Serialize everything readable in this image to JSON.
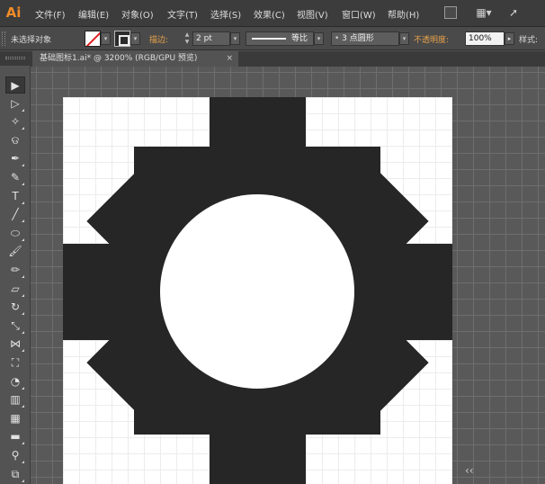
{
  "app": {
    "logo_text": "Ai"
  },
  "menu": {
    "items": [
      "文件(F)",
      "编辑(E)",
      "对象(O)",
      "文字(T)",
      "选择(S)",
      "效果(C)",
      "视图(V)",
      "窗口(W)",
      "帮助(H)"
    ],
    "right_icons": [
      "bridge-icon",
      "workspace-layout-icon",
      "rocket-icon"
    ]
  },
  "control_bar": {
    "selection_label": "未选择对象",
    "stroke_label": "描边:",
    "stroke_weight": "2 pt",
    "stroke_profile": "等比",
    "brush_label": "3 点圆形",
    "opacity_label": "不透明度:",
    "opacity_value": "100%",
    "style_label": "样式:"
  },
  "document": {
    "tab_title": "基础图标1.ai* @ 3200% (RGB/GPU 预览)",
    "close_glyph": "×"
  },
  "toolbar": {
    "tools": [
      {
        "name": "selection-tool",
        "glyph": "▶",
        "active": true
      },
      {
        "name": "direct-selection-tool",
        "glyph": "▷"
      },
      {
        "name": "magic-wand-tool",
        "glyph": "✧"
      },
      {
        "name": "lasso-tool",
        "glyph": "ଡ"
      },
      {
        "name": "pen-tool",
        "glyph": "✒"
      },
      {
        "name": "curvature-tool",
        "glyph": "✎"
      },
      {
        "name": "type-tool",
        "glyph": "T"
      },
      {
        "name": "line-segment-tool",
        "glyph": "╱"
      },
      {
        "name": "ellipse-tool",
        "glyph": "⬭"
      },
      {
        "name": "paintbrush-tool",
        "glyph": "🖌"
      },
      {
        "name": "pencil-tool",
        "glyph": "✏"
      },
      {
        "name": "eraser-tool",
        "glyph": "▱"
      },
      {
        "name": "rotate-tool",
        "glyph": "↻"
      },
      {
        "name": "scale-tool",
        "glyph": "⤡"
      },
      {
        "name": "width-tool",
        "glyph": "⋈"
      },
      {
        "name": "free-transform-tool",
        "glyph": "⛶"
      },
      {
        "name": "shape-builder-tool",
        "glyph": "◔"
      },
      {
        "name": "graph-tool",
        "glyph": "▥"
      },
      {
        "name": "mesh-tool",
        "glyph": "▦"
      },
      {
        "name": "gradient-tool",
        "glyph": "▬"
      },
      {
        "name": "eyedropper-tool",
        "glyph": "⚲"
      },
      {
        "name": "blend-tool",
        "glyph": "⧉"
      }
    ]
  },
  "artwork": {
    "shape": "gear-icon",
    "gear_color": "#262626",
    "hole_color": "#ffffff"
  },
  "colors": {
    "accent_orange": "#f08c28",
    "label_orange": "#e8a34a"
  }
}
